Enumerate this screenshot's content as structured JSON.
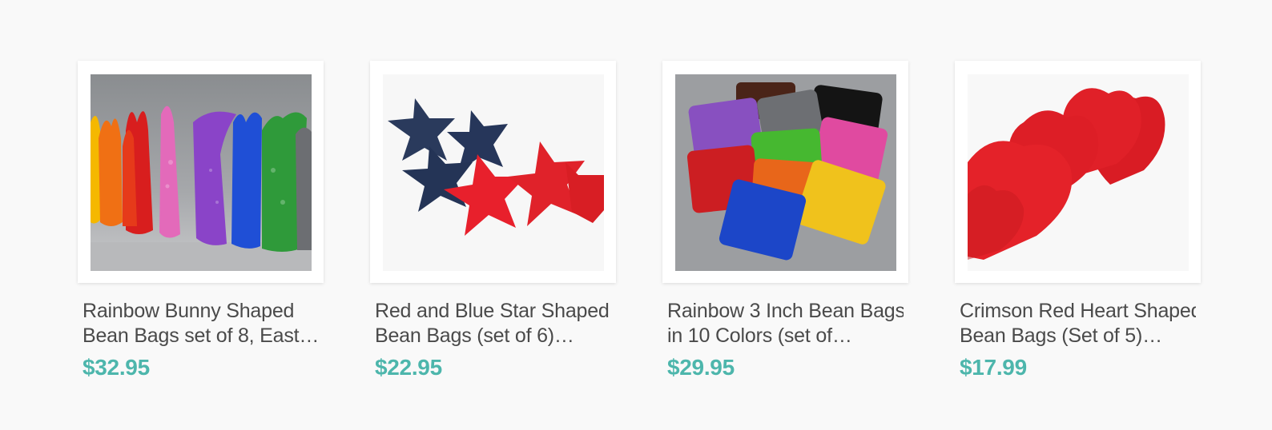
{
  "products": [
    {
      "title_line1": "Rainbow Bunny Shaped",
      "title_line2": "Bean Bags set of 8, East…",
      "price": "$32.95"
    },
    {
      "title_line1": "Red and Blue Star Shaped",
      "title_line2": "Bean Bags (set of 6)…",
      "price": "$22.95"
    },
    {
      "title_line1": "Rainbow 3 Inch Bean Bags",
      "title_line2": "in 10 Colors (set of…",
      "price": "$29.95"
    },
    {
      "title_line1": "Crimson Red Heart Shaped",
      "title_line2": "Bean Bags (Set of 5)…",
      "price": "$17.99"
    }
  ],
  "colors": {
    "price": "#4db6ac",
    "title": "#4a4a4a",
    "background": "#f9f9f9"
  }
}
